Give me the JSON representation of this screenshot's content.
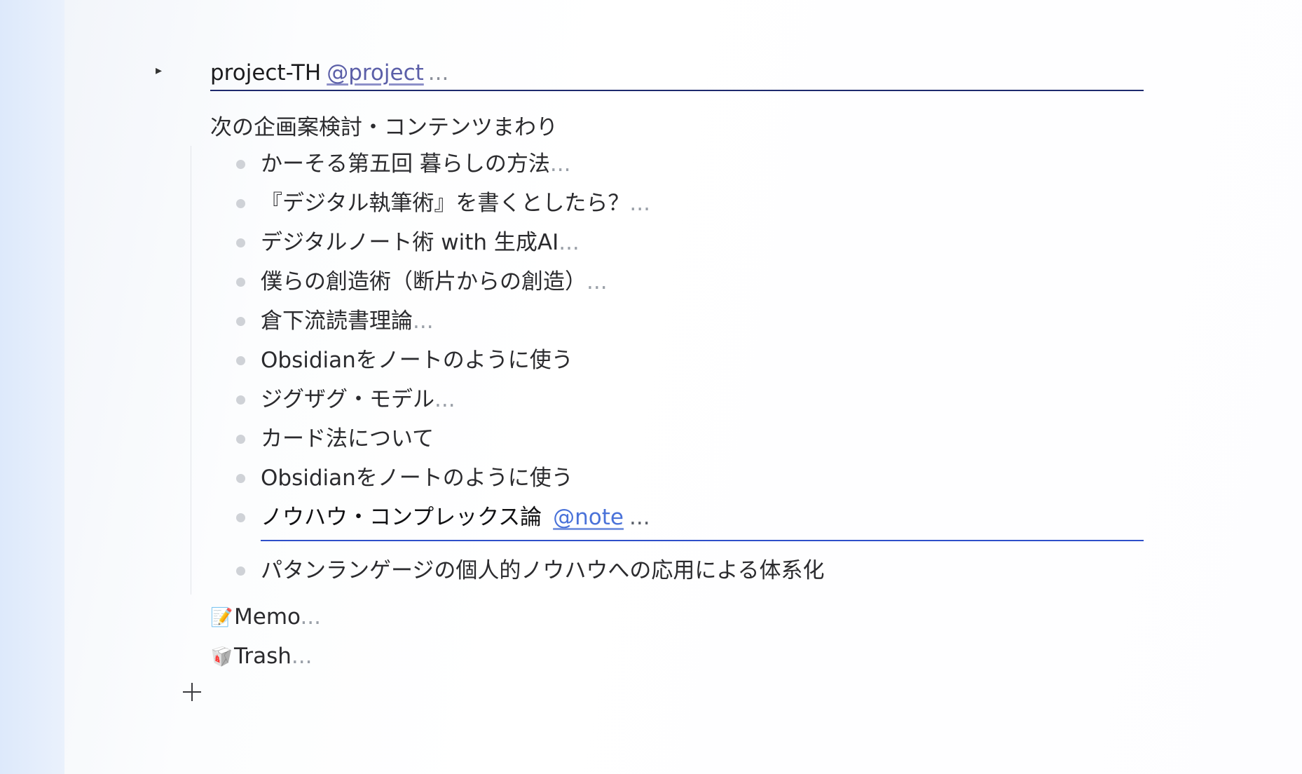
{
  "project": {
    "toggle_glyph": "▸",
    "name": "project-TH",
    "tag": "@project",
    "ellipsis": "..."
  },
  "section": {
    "heading": "次の企画案検討・コンテンツまわり"
  },
  "items": [
    {
      "label": "かーそる第五回 暮らしの方法",
      "more": "..."
    },
    {
      "label": "『デジタル執筆術』を書くとしたら？",
      "more": "..."
    },
    {
      "label": "デジタルノート術 with 生成AI",
      "more": "..."
    },
    {
      "label": "僕らの創造術（断片からの創造）",
      "more": "..."
    },
    {
      "label": "倉下流読書理論",
      "more": "..."
    },
    {
      "label": "Obsidianをノートのように使う",
      "more": ""
    },
    {
      "label": "ジグザグ・モデル",
      "more": "..."
    },
    {
      "label": "カード法について",
      "more": ""
    },
    {
      "label": "Obsidianをノートのように使う",
      "more": ""
    }
  ],
  "active_item": {
    "label": "ノウハウ・コンプレックス論",
    "tag": "@note",
    "ellipsis": "..."
  },
  "last_item": {
    "label": "パタンランゲージの個人的ノウハウへの応用による体系化",
    "more": ""
  },
  "folders": {
    "memo": {
      "emoji": "📝",
      "label": "Memo",
      "more": "..."
    },
    "trash": {
      "emoji": "🥡",
      "label": "Trash",
      "more": "..."
    }
  },
  "add_button_icon": "plus-icon"
}
